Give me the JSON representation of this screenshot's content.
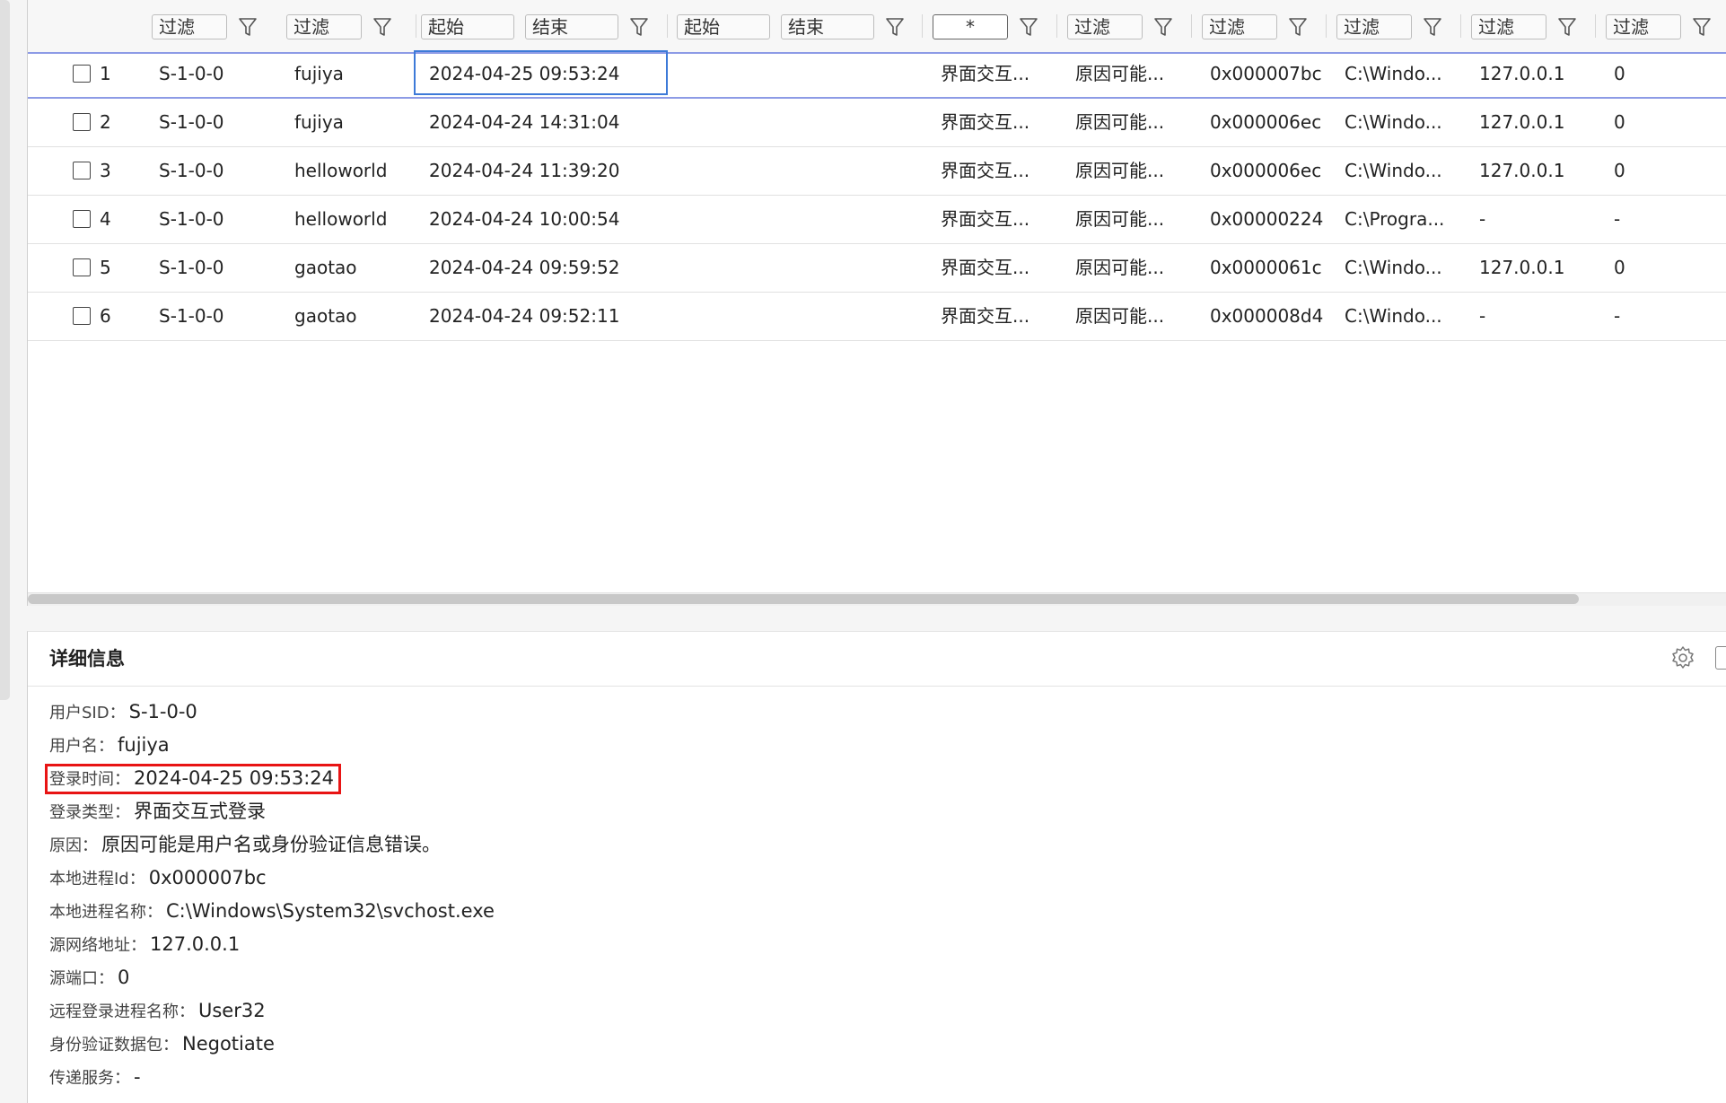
{
  "filters": [
    {
      "label": "过滤"
    },
    {
      "label": "过滤"
    },
    {
      "label": "起始"
    },
    {
      "label": "结束"
    },
    {
      "label": "起始"
    },
    {
      "label": "结束"
    },
    {
      "label": "*"
    },
    {
      "label": "过滤"
    },
    {
      "label": "过滤"
    },
    {
      "label": "过滤"
    },
    {
      "label": "过滤"
    },
    {
      "label": "过滤"
    }
  ],
  "rows": [
    {
      "index": "1",
      "sid": "S-1-0-0",
      "user": "fujiya",
      "time": "2024-04-25 09:53:24",
      "type": "界面交互...",
      "reason": "原因可能...",
      "pid": "0x000007bc",
      "path": "C:\\Windo...",
      "ip": "127.0.0.1",
      "port": "0"
    },
    {
      "index": "2",
      "sid": "S-1-0-0",
      "user": "fujiya",
      "time": "2024-04-24 14:31:04",
      "type": "界面交互...",
      "reason": "原因可能...",
      "pid": "0x000006ec",
      "path": "C:\\Windo...",
      "ip": "127.0.0.1",
      "port": "0"
    },
    {
      "index": "3",
      "sid": "S-1-0-0",
      "user": "helloworld",
      "time": "2024-04-24 11:39:20",
      "type": "界面交互...",
      "reason": "原因可能...",
      "pid": "0x000006ec",
      "path": "C:\\Windo...",
      "ip": "127.0.0.1",
      "port": "0"
    },
    {
      "index": "4",
      "sid": "S-1-0-0",
      "user": "helloworld",
      "time": "2024-04-24 10:00:54",
      "type": "界面交互...",
      "reason": "原因可能...",
      "pid": "0x00000224",
      "path": "C:\\Progra...",
      "ip": "-",
      "port": "-"
    },
    {
      "index": "5",
      "sid": "S-1-0-0",
      "user": "gaotao",
      "time": "2024-04-24 09:59:52",
      "type": "界面交互...",
      "reason": "原因可能...",
      "pid": "0x0000061c",
      "path": "C:\\Windo...",
      "ip": "127.0.0.1",
      "port": "0"
    },
    {
      "index": "6",
      "sid": "S-1-0-0",
      "user": "gaotao",
      "time": "2024-04-24 09:52:11",
      "type": "界面交互...",
      "reason": "原因可能...",
      "pid": "0x000008d4",
      "path": "C:\\Windo...",
      "ip": "-",
      "port": "-"
    }
  ],
  "details": {
    "title": "详细信息",
    "fields": [
      {
        "label": "用户SID：",
        "value": "S-1-0-0"
      },
      {
        "label": "用户名：",
        "value": "fujiya"
      },
      {
        "label": "登录时间：",
        "value": "2024-04-25 09:53:24"
      },
      {
        "label": "登录类型：",
        "value": "界面交互式登录"
      },
      {
        "label": "原因：",
        "value": "原因可能是用户名或身份验证信息错误。"
      },
      {
        "label": "本地进程Id：",
        "value": "0x000007bc"
      },
      {
        "label": "本地进程名称：",
        "value": "C:\\Windows\\System32\\svchost.exe"
      },
      {
        "label": "源网络地址：",
        "value": "127.0.0.1"
      },
      {
        "label": "源端口：",
        "value": "0"
      },
      {
        "label": "远程登录进程名称：",
        "value": "User32"
      },
      {
        "label": "身份验证数据包：",
        "value": "Negotiate"
      },
      {
        "label": "传递服务：",
        "value": "-"
      }
    ]
  },
  "colors": {
    "accent": "#3d7ad8",
    "row_divider": "#8d9be6",
    "highlight": "#e81414"
  },
  "icons": {
    "filter": "funnel-icon",
    "settings": "gear-icon",
    "panel": "expand-panel-icon"
  }
}
